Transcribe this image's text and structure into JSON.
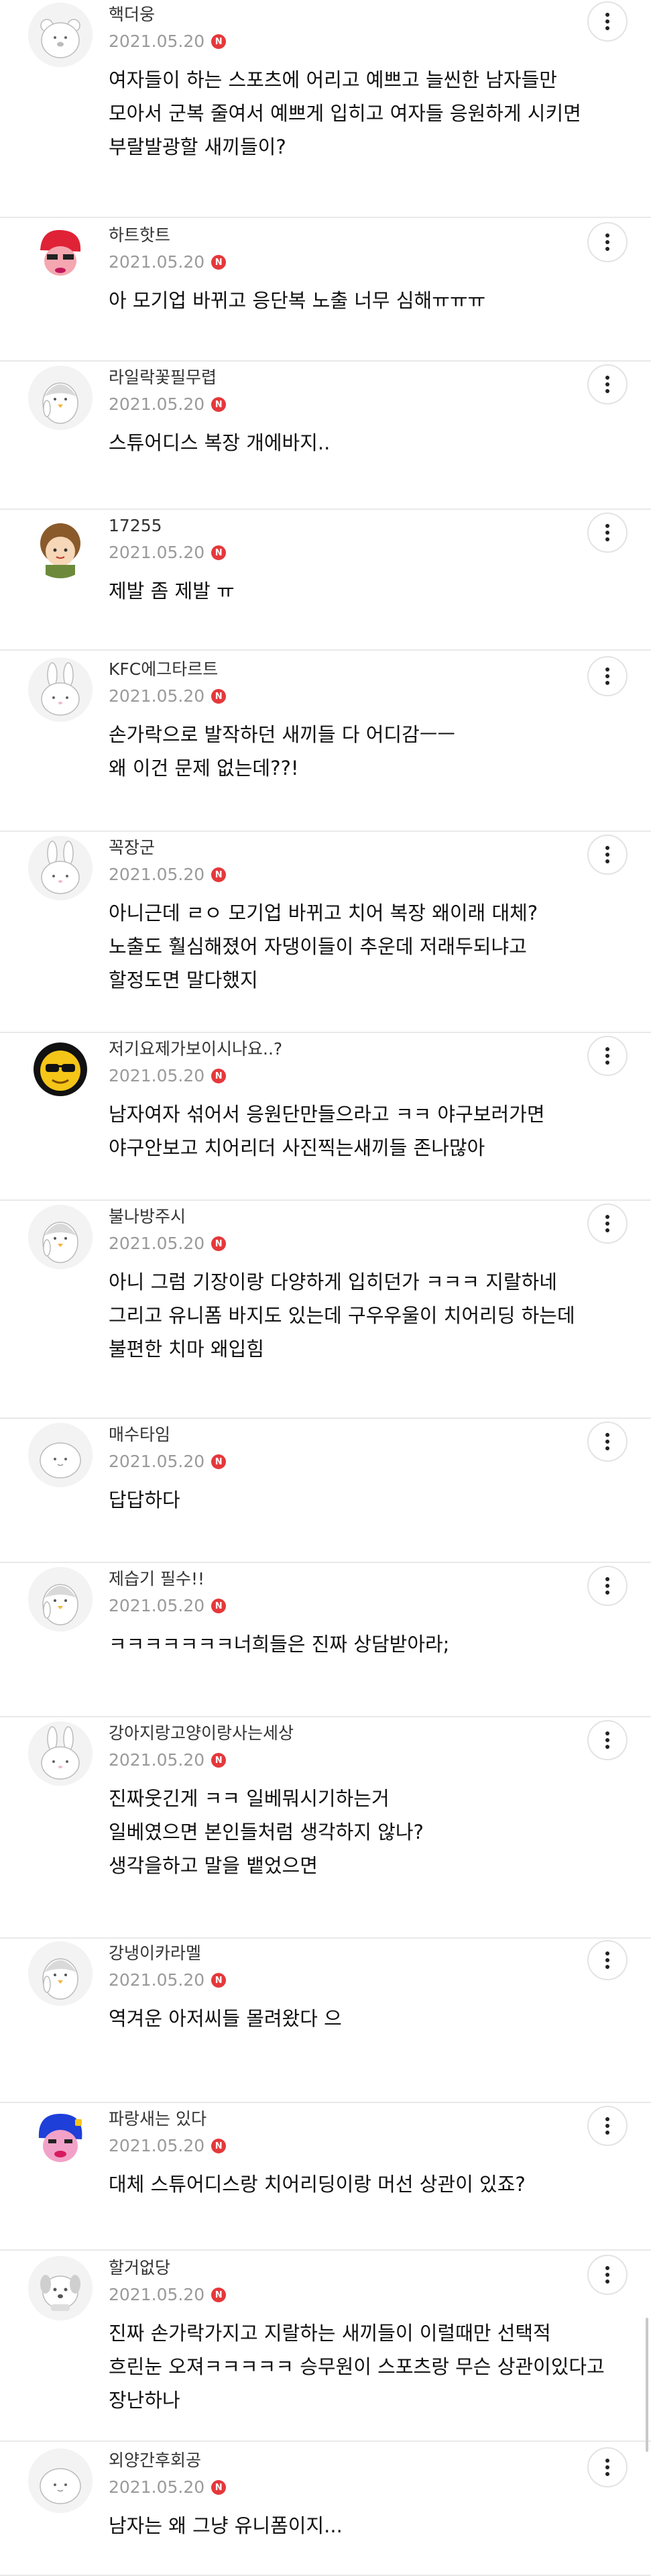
{
  "comments": [
    {
      "nickname": "핵더웅",
      "date": "2021.05.20",
      "badge": "N",
      "avatar_icon": "bear-avatar-icon",
      "lines": [
        "여자들이 하는 스포츠에 어리고 예쁘고 늘씬한 남자들만",
        "모아서 군복 줄여서 예쁘게 입히고 여자들 응원하게 시키면",
        "부랄발광할 새끼들이?"
      ]
    },
    {
      "nickname": "하트핫트",
      "date": "2021.05.20",
      "badge": "N",
      "avatar_icon": "red-character-avatar-icon",
      "lines": [
        "아 모기업 바뀌고 응단복 노출 너무 심해ㅠㅠㅠ"
      ]
    },
    {
      "nickname": "라일락꽃필무렵",
      "date": "2021.05.20",
      "badge": "N",
      "avatar_icon": "penguin-avatar-icon",
      "lines": [
        "스튜어디스 복장 개에바지.."
      ]
    },
    {
      "nickname": "17255",
      "date": "2021.05.20",
      "badge": "N",
      "avatar_icon": "girl-avatar-icon",
      "lines": [
        "제발 좀 제발 ㅠ"
      ]
    },
    {
      "nickname": "KFC에그타르트",
      "date": "2021.05.20",
      "badge": "N",
      "avatar_icon": "rabbit-avatar-icon",
      "lines": [
        "손가락으로 발작하던 새끼들 다 어디감ㅡㅡ",
        "왜 이건 문제 없는데??!"
      ]
    },
    {
      "nickname": "꼭장군",
      "date": "2021.05.20",
      "badge": "N",
      "avatar_icon": "rabbit-avatar-icon",
      "lines": [
        "아니근데 ㄹㅇ 모기업 바뀌고 치어 복장 왜이래 대체?",
        "노출도 훨심해졌어 자댕이들이 추운데 저래두되냐고",
        "할정도면 말다했지"
      ]
    },
    {
      "nickname": "저기요제가보이시나요..?",
      "date": "2021.05.20",
      "badge": "N",
      "avatar_icon": "sunglasses-emoji-avatar-icon",
      "lines": [
        "남자여자 섞어서 응원단만들으라고 ㅋㅋ 야구보러가면",
        "야구안보고 치어리더 사진찍는새끼들 존나많아"
      ]
    },
    {
      "nickname": "불나방주시",
      "date": "2021.05.20",
      "badge": "N",
      "avatar_icon": "penguin-avatar-icon",
      "lines": [
        "아니 그럼 기장이랑 다양하게 입히던가 ㅋㅋㅋ 지랄하네",
        "그리고 유니폼 바지도 있는데 구우우울이 치어리딩 하는데",
        "불편한 치마 왜입힘"
      ]
    },
    {
      "nickname": "매수타임",
      "date": "2021.05.20",
      "badge": "N",
      "avatar_icon": "blob-avatar-icon",
      "lines": [
        "답답하다"
      ]
    },
    {
      "nickname": "제습기 필수!!",
      "date": "2021.05.20",
      "badge": "N",
      "avatar_icon": "penguin-avatar-icon",
      "lines": [
        "ㅋㅋㅋㅋㅋㅋㅋ너희들은 진짜 상담받아라;"
      ]
    },
    {
      "nickname": "강아지랑고양이랑사는세상",
      "date": "2021.05.20",
      "badge": "N",
      "avatar_icon": "rabbit-avatar-icon",
      "lines": [
        "진짜웃긴게 ㅋㅋ 일베뭐시기하는거",
        "일베였으면 본인들처럼 생각하지 않나?",
        "생각을하고 말을 뱉었으면"
      ]
    },
    {
      "nickname": "강냉이카라멜",
      "date": "2021.05.20",
      "badge": "N",
      "avatar_icon": "penguin-avatar-icon",
      "lines": [
        "역겨운 아저씨들 몰려왔다 으"
      ]
    },
    {
      "nickname": "파랑새는 있다",
      "date": "2021.05.20",
      "badge": "N",
      "avatar_icon": "blue-hair-character-avatar-icon",
      "lines": [
        "대체 스튜어디스랑 치어리딩이랑 머선 상관이 있죠?"
      ]
    },
    {
      "nickname": "할거없당",
      "date": "2021.05.20",
      "badge": "N",
      "avatar_icon": "dog-avatar-icon",
      "lines": [
        "진짜 손가락가지고 지랄하는 새끼들이 이럴때만 선택적",
        "흐린눈 오져ㅋㅋㅋㅋㅋ 승무원이 스포츠랑 무슨 상관이있다고",
        "장난하나"
      ]
    },
    {
      "nickname": "외양간후회공",
      "date": "2021.05.20",
      "badge": "N",
      "avatar_icon": "blob-avatar-icon",
      "lines": [
        "남자는 왜 그냥 유니폼이지..."
      ]
    }
  ],
  "more_icon": "more-vertical-icon",
  "colors": {
    "badge": "#e5383b",
    "divider": "#e9e9e9",
    "date": "#9a9a9a",
    "nickname": "#333333",
    "text": "#111111"
  }
}
